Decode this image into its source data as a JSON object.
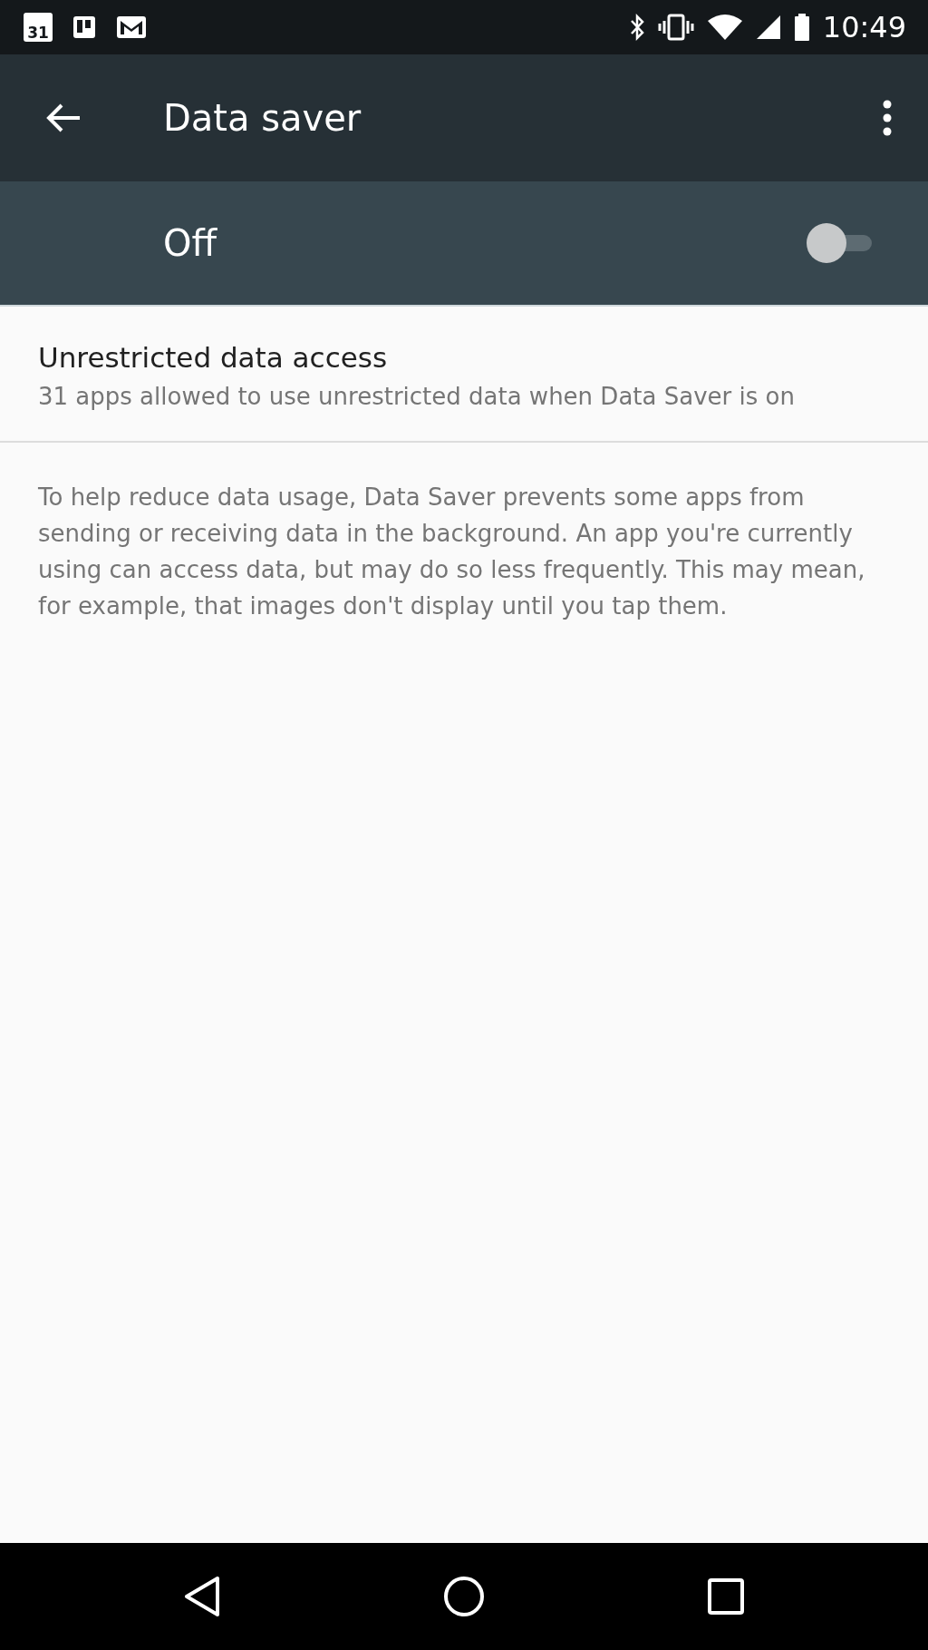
{
  "status_bar": {
    "time": "10:49",
    "calendar_day": "31"
  },
  "toolbar": {
    "title": "Data saver"
  },
  "master_switch": {
    "label": "Off",
    "on": false
  },
  "items": [
    {
      "title": "Unrestricted data access",
      "summary": "31 apps allowed to use unrestricted data when Data Saver is on"
    }
  ],
  "footer_text": "To help reduce data usage, Data Saver prevents some apps from sending or receiving data in the background. An app you're currently using can access data, but may do so less frequently. This may mean, for example, that images don't display until you tap them."
}
